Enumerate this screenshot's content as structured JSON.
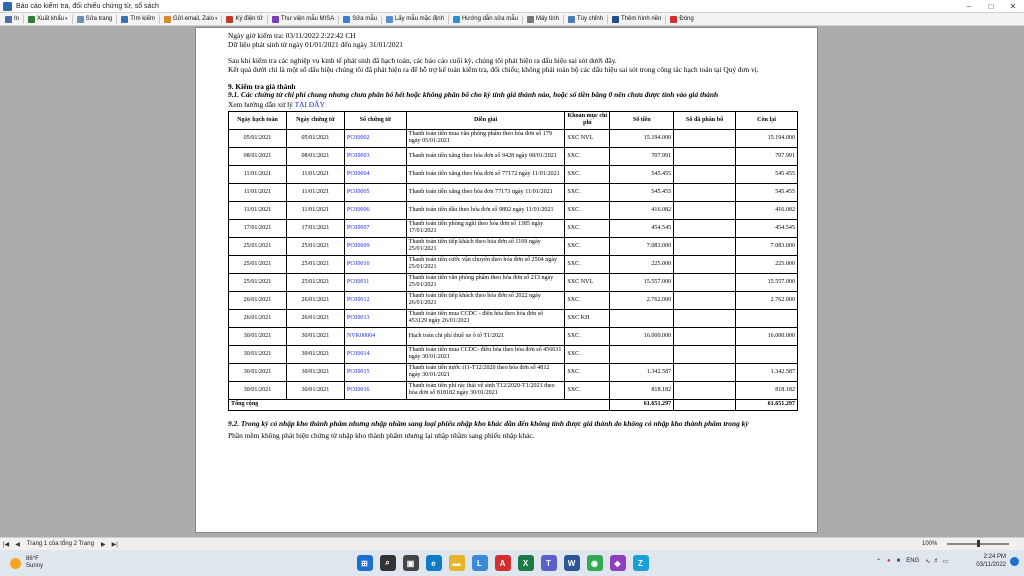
{
  "window": {
    "title": "Báo cáo kiểm tra, đối chiếu chứng từ, sổ sách"
  },
  "toolbar": {
    "items": [
      {
        "label": "In",
        "icon": "printer-icon",
        "color": "#4a6ea8"
      },
      {
        "label": "Xuất khẩu",
        "icon": "export-icon",
        "color": "#2e7d32",
        "dropdown": "▾"
      },
      {
        "label": "Sửa trang",
        "icon": "page-edit-icon",
        "color": "#6d8fb8"
      },
      {
        "label": "Tìm kiếm",
        "icon": "search-icon",
        "color": "#3b6fb6"
      },
      {
        "label": "Gửi email, Zalo",
        "icon": "email-icon",
        "color": "#d9892a",
        "dropdown": "▾"
      },
      {
        "label": "Ký điện tử",
        "icon": "signature-icon",
        "color": "#c0392b"
      },
      {
        "label": "Thư viện mẫu MISA",
        "icon": "library-icon",
        "color": "#7a3db8"
      },
      {
        "label": "Sửa mẫu",
        "icon": "edit-template-icon",
        "color": "#3a7bd5"
      },
      {
        "label": "Lấy mẫu mặc định",
        "icon": "default-template-icon",
        "color": "#5a8fcf"
      },
      {
        "label": "Hướng dẫn sửa mẫu",
        "icon": "help-icon",
        "color": "#2a8fd4"
      },
      {
        "label": "Máy tính",
        "icon": "calculator-icon",
        "color": "#777777"
      },
      {
        "label": "Tùy chỉnh",
        "icon": "settings-icon",
        "color": "#4a7ab8"
      },
      {
        "label": "Thêm hình nền",
        "icon": "background-icon",
        "color": "#1f4f8f"
      },
      {
        "label": "Đóng",
        "icon": "close-icon",
        "color": "#d32f2f"
      }
    ]
  },
  "report": {
    "check_time": "Ngày giờ kiểm tra: 03/11/2022 2:22:42 CH",
    "data_period": "Dữ liệu phát sinh từ ngày 01/01/2021 đến ngày 31/01/2021",
    "intro_1": "Sau khi kiểm tra các nghiệp vụ kinh tế phát sinh đã hạch toán, các báo cáo cuối kỳ, chúng tôi phát hiện ra dấu hiệu sai sót dưới đây.",
    "intro_2": "Kết quả dưới chỉ là một số dấu hiệu chúng tôi đã phát hiện ra để hỗ trợ kế toán kiểm tra, đối chiếu; không phải toàn bộ các dấu hiệu sai sót trong công tác hạch toán tại Quý đơn vị.",
    "section_title": "9. Kiểm tra giá thành",
    "sub_9_1": "9.1. Các chứng từ chi phí chung nhưng chưa phân bổ hết hoặc không phân bổ cho kỳ tính giá thành nào, hoặc số tiền bằng 0 nên chưa được tính vào giá thành",
    "guide_text": "Xem hướng dẫn xử lý",
    "guide_link": "TẠI ĐÂY",
    "columns": [
      "Ngày hạch toán",
      "Ngày chứng từ",
      "Số chứng từ",
      "Diễn giải",
      "Khoản mục chi phí",
      "Số tiền",
      "Số đã phân bổ",
      "Còn lại"
    ],
    "rows": [
      [
        "05/01/2021",
        "05/01/2021",
        "PC00002",
        "Thanh toán tiền mua văn phòng phẩm theo hóa đơn số 179 ngày 05/01/2021",
        "SXC NVL",
        "15.194.000",
        "",
        "15.194.000"
      ],
      [
        "08/01/2021",
        "08/01/2021",
        "PC00003",
        "Thanh toán tiền xăng theo hóa đơn số 9428 ngày 08/01/2021",
        "SXC.",
        "707.991",
        "",
        "707.991"
      ],
      [
        "11/01/2021",
        "11/01/2021",
        "PC00004",
        "Thanh toán tiền xăng theo hóa đơn số 77172 ngày 11/01/2021",
        "SXC.",
        "545.455",
        "",
        "545.455"
      ],
      [
        "11/01/2021",
        "11/01/2021",
        "PC00005",
        "Thanh toán tiền xăng theo hóa đơn 77173 ngày 11/01/2021",
        "SXC.",
        "545.455",
        "",
        "545.455"
      ],
      [
        "11/01/2021",
        "11/01/2021",
        "PC00006",
        "Thanh toán tiền dầu theo hóa đơn số 9892 ngày 11/01/2021",
        "SXC.",
        "416.082",
        "",
        "416.082"
      ],
      [
        "17/01/2021",
        "17/01/2021",
        "PC00007",
        "Thanh toán tiền phòng nghỉ theo hóa đơn số 1385 ngày 17/01/2021",
        "SXC.",
        "454.545",
        "",
        "454.545"
      ],
      [
        "25/01/2021",
        "25/01/2021",
        "PC00009",
        "Thanh toán tiền tiếp khách theo hóa đơn số 1169 ngày 25/01/2021",
        "SXC.",
        "7.083.000",
        "",
        "7.083.000"
      ],
      [
        "25/01/2021",
        "25/01/2021",
        "PC00010",
        "Thanh toán tiền cước vận chuyển theo hóa đơn số 2504 ngày 25/01/2021",
        "SXC.",
        "225.000",
        "",
        "225.000"
      ],
      [
        "25/01/2021",
        "25/01/2021",
        "PC00011",
        "Thanh toán tiền văn phòng phẩm theo hóa đơn số 213 ngày 25/01/2021",
        "SXC NVL",
        "15.557.000",
        "",
        "15.557.000"
      ],
      [
        "26/01/2021",
        "26/01/2021",
        "PC00012",
        "Thanh toán tiền tiếp khách theo hóa đơn số 2022 ngày 26/01/2021",
        "SXC.",
        "2.762.000",
        "",
        "2.762.000"
      ],
      [
        "26/01/2021",
        "26/01/2021",
        "PC00013",
        "Thanh toán tiền mua CCDC - điều hòa theo hóa đơn số 453129 ngày 26/01/2021",
        "SXC KH",
        "",
        "",
        ""
      ],
      [
        "30/01/2021",
        "30/01/2021",
        "NVK00004",
        "Hạch toán chi phí thuê xe ô tô T1/2021",
        "SXC.",
        "16.000.000",
        "",
        "16.000.000"
      ],
      [
        "30/01/2021",
        "30/01/2021",
        "PC00014",
        "Thanh toán tiền mua CCDC- điều hòa theo hóa đơn số 456631 ngày 30/01/2021",
        "SXC.",
        "",
        "",
        ""
      ],
      [
        "30/01/2021",
        "30/01/2021",
        "PC00015",
        "Thanh toán tiền nước t11-T12/2020 theo hóa đơn số 4812 ngày 30/01/2021",
        "SXC.",
        "1.342.587",
        "",
        "1.342.587"
      ],
      [
        "30/01/2021",
        "30/01/2021",
        "PC00016",
        "Thanh toán tiền phí rác thải vệ sinh T12/2020-T1/2021 theo hóa đơn số 818182 ngày 30/01/2021",
        "SXC.",
        "818.182",
        "",
        "818.182"
      ]
    ],
    "total_label": "Tổng cộng",
    "total_amount": "61.651.297",
    "total_remaining": "61.651.297",
    "sub_9_2": "9.2. Trong kỳ có nhập kho thành phẩm nhưng nhập nhầm sang loại phiếu nhập kho khác dẫn đến không tính được giá thành do không có nhập kho thành phẩm trong kỳ",
    "note_9_2": "Phần mềm không phát hiện chứng từ nhập kho thành phẩm nhưng lại nhập nhầm sang phiếu nhập khác."
  },
  "statusbar": {
    "page_info": "Trang 1 của tổng 2 Trang",
    "zoom": "100%",
    "zoom_level": 0.5
  },
  "taskbar": {
    "temperature": "86°F",
    "weather": "Sunny",
    "language": "ENG",
    "time": "2:24 PM",
    "date": "03/11/2022",
    "apps": [
      {
        "icon": "windows-start-icon",
        "color": "#1f6fd1",
        "glyph": "⊞"
      },
      {
        "icon": "search-icon",
        "color": "#333333",
        "glyph": "⌕"
      },
      {
        "icon": "task-view-icon",
        "color": "#444444",
        "glyph": "▣"
      },
      {
        "icon": "edge-icon",
        "color": "#0f7bc6",
        "glyph": "e"
      },
      {
        "icon": "file-explorer-icon",
        "color": "#e8b229",
        "glyph": "▬"
      },
      {
        "icon": "app-l-icon",
        "color": "#3b8ad9",
        "glyph": "L"
      },
      {
        "icon": "acrobat-icon",
        "color": "#d42e2e",
        "glyph": "A"
      },
      {
        "icon": "excel-icon",
        "color": "#1e7a45",
        "glyph": "X"
      },
      {
        "icon": "teams-icon",
        "color": "#5b5fc7",
        "glyph": "T"
      },
      {
        "icon": "word-icon",
        "color": "#2b5797",
        "glyph": "W"
      },
      {
        "icon": "chrome-icon",
        "color": "#34a853",
        "glyph": "◉"
      },
      {
        "icon": "app-purple-icon",
        "color": "#8e3fbf",
        "glyph": "◆"
      },
      {
        "icon": "zalo-icon",
        "color": "#1aa0d8",
        "glyph": "Z"
      }
    ]
  }
}
